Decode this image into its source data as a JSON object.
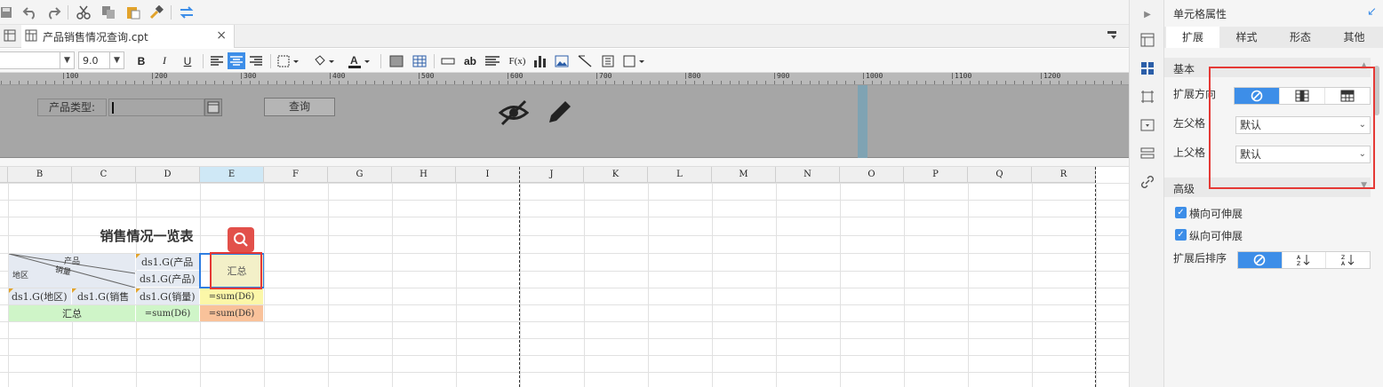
{
  "toolbar": {
    "icons": [
      "save-icon",
      "undo-icon",
      "redo-icon",
      "cut-icon",
      "copy-icon",
      "paste-icon",
      "format-painter-icon",
      "switch-icon"
    ]
  },
  "tab": {
    "title": "产品销售情况查询.cpt",
    "close": "×"
  },
  "format": {
    "font_size": "9.0",
    "bold": "B",
    "italic": "I",
    "underline": "U",
    "text_ab": "ab",
    "fx": "F(x)"
  },
  "ruler": {
    "ticks": [
      "100",
      "200",
      "300",
      "400",
      "500",
      "600",
      "700",
      "800",
      "900",
      "1000",
      "1100",
      "1200"
    ]
  },
  "param": {
    "label": "产品类型:",
    "query_button": "查询"
  },
  "columns": [
    "B",
    "C",
    "D",
    "E",
    "F",
    "G",
    "H",
    "I",
    "J",
    "K",
    "L",
    "M",
    "N",
    "O",
    "P",
    "Q",
    "R"
  ],
  "report": {
    "title": "销售情况一览表",
    "hdr_product": "产品",
    "hdr_sales": "销量",
    "hdr_region": "地区",
    "d_product_top": "ds1.G(产品",
    "d_product": "ds1.G(产品)",
    "summary_cell": "汇总",
    "b_region": "ds1.G(地区)",
    "c_sales": "ds1.G(销售",
    "d_sales": "ds1.G(销量)",
    "e_sum": "=sum(D6)",
    "total_label": "汇总",
    "d_total": "=sum(D6)",
    "e_total": "=sum(D6)"
  },
  "panel": {
    "title": "单元格属性",
    "tabs": [
      "扩展",
      "样式",
      "形态",
      "其他"
    ],
    "section_basic": "基本",
    "expand_direction": "扩展方向",
    "left_parent": "左父格",
    "left_parent_value": "默认",
    "top_parent": "上父格",
    "top_parent_value": "默认",
    "section_advanced": "高级",
    "h_extend": "横向可伸展",
    "v_extend": "纵向可伸展",
    "sort_after": "扩展后排序"
  },
  "colors": {
    "accent": "#3d8ee8",
    "highlight_red": "#e53935"
  }
}
